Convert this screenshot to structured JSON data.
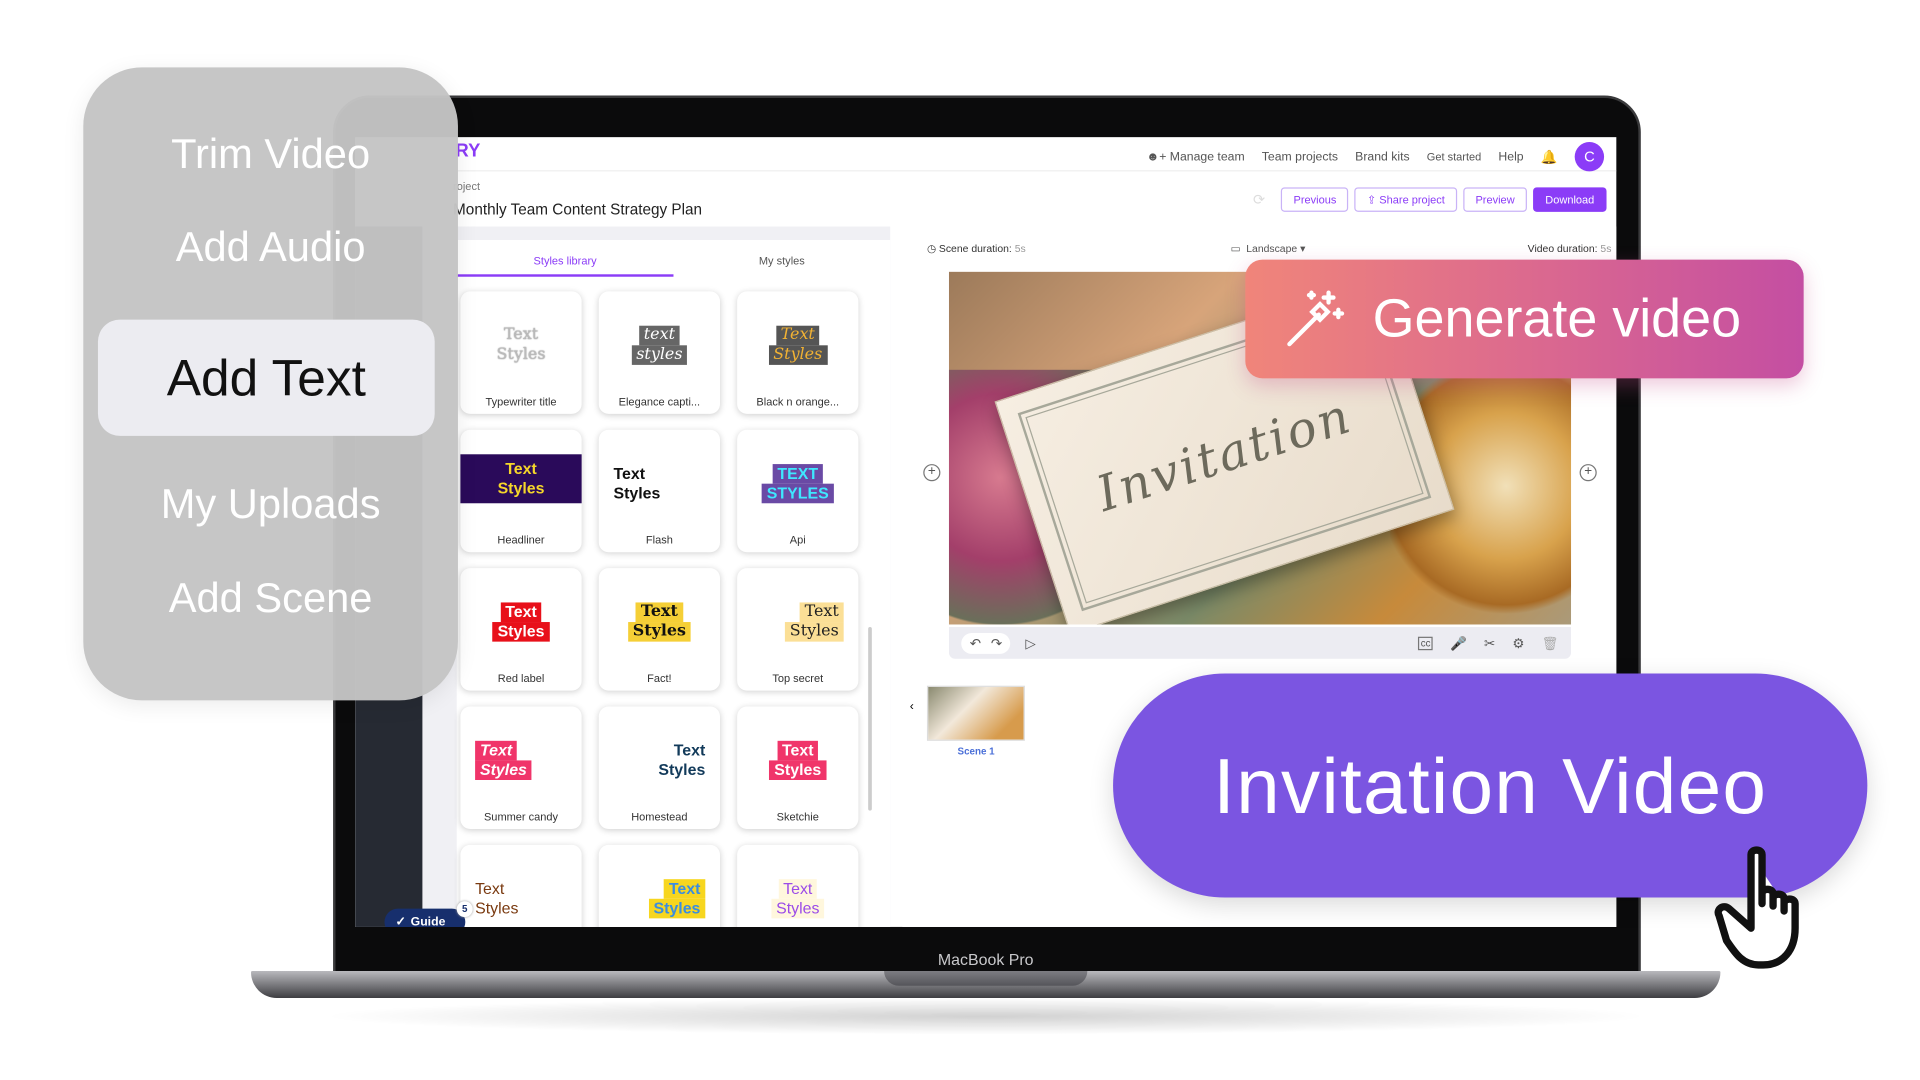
{
  "device_label": "MacBook Pro",
  "header": {
    "logo": "RY",
    "nav": [
      "Manage team",
      "Team projects",
      "Brand kits",
      "Get started",
      "Help"
    ],
    "avatar": "C"
  },
  "project": {
    "breadcrumb": "roject",
    "title": "Monthly Team Content Strategy Plan",
    "buttons": {
      "previous": "Previous",
      "share": "Share project",
      "preview": "Preview",
      "download": "Download"
    }
  },
  "panel": {
    "tabs": [
      "Styles library",
      "My styles"
    ],
    "cards": [
      {
        "label": "Typewriter title",
        "preview": [
          "Text",
          "Styles"
        ]
      },
      {
        "label": "Elegance capti...",
        "preview": [
          "text",
          "styles"
        ]
      },
      {
        "label": "Black n orange...",
        "preview": [
          "Text",
          "Styles"
        ]
      },
      {
        "label": "Headliner",
        "preview": [
          "Text",
          "Styles"
        ]
      },
      {
        "label": "Flash",
        "preview": [
          "Text",
          "Styles"
        ]
      },
      {
        "label": "Api",
        "preview": [
          "TEXT",
          "STYLES"
        ]
      },
      {
        "label": "Red label",
        "preview": [
          "Text",
          "Styles"
        ]
      },
      {
        "label": "Fact!",
        "preview": [
          "Text",
          "Styles"
        ]
      },
      {
        "label": "Top secret",
        "preview": [
          "Text",
          "Styles"
        ]
      },
      {
        "label": "Summer candy",
        "preview": [
          "Text",
          "Styles"
        ]
      },
      {
        "label": "Homestead",
        "preview": [
          "Text",
          "Styles"
        ]
      },
      {
        "label": "Sketchie",
        "preview": [
          "Text",
          "Styles"
        ]
      },
      {
        "label": "",
        "preview": [
          "Text",
          "Styles"
        ]
      },
      {
        "label": "",
        "preview": [
          "Text",
          "Styles"
        ]
      },
      {
        "label": "",
        "preview": [
          "Text",
          "Styles"
        ]
      }
    ]
  },
  "editor": {
    "scene_duration_label": "Scene duration:",
    "scene_duration": "5s",
    "orientation": "Landscape",
    "video_duration_label": "Video duration:",
    "video_duration": "5s",
    "video_text": "Invitation",
    "scene_label": "Scene 1"
  },
  "guide": {
    "label": "Guide",
    "count": "5"
  },
  "overlay_menu": {
    "items": [
      "Trim Video",
      "Add Audio",
      "Add Text",
      "My Uploads",
      "Add Scene"
    ],
    "active": "Add Text"
  },
  "generate_button": "Generate video",
  "title_pill": "Invitation Video",
  "colors": {
    "accent": "#8b3cf7",
    "pill": "#7b55e1",
    "generate_start": "#f0857a",
    "generate_end": "#c44ea2"
  }
}
